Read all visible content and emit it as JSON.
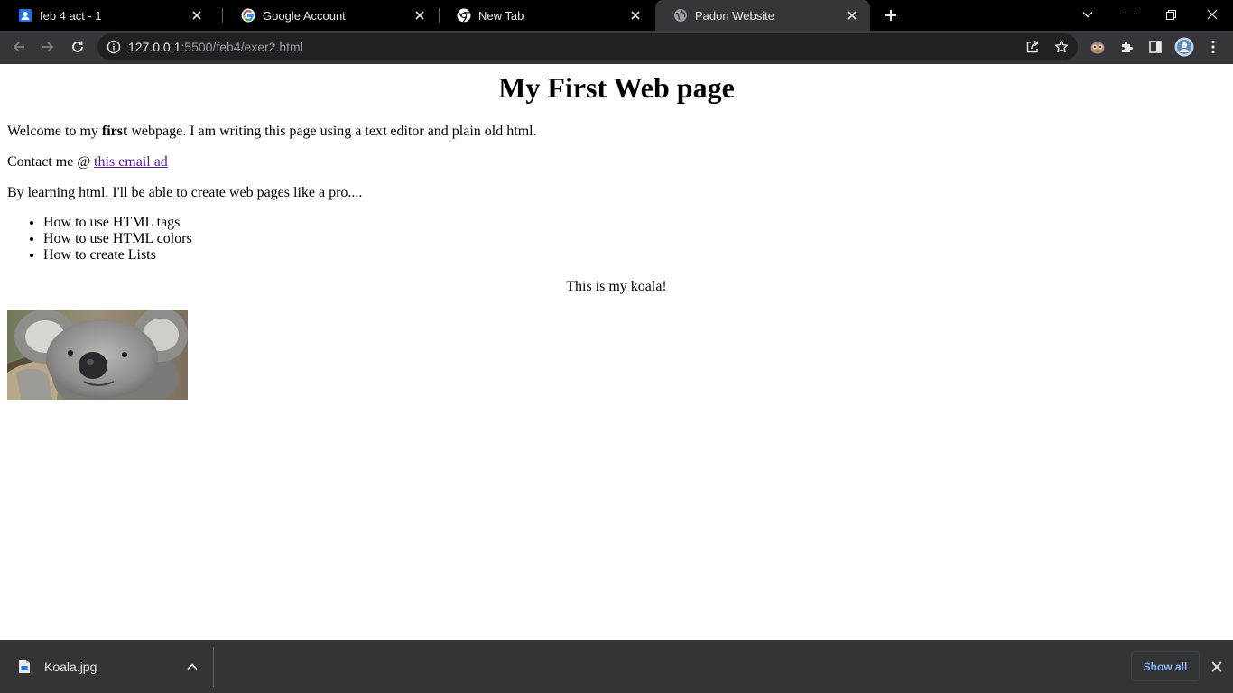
{
  "browser": {
    "tabs": [
      {
        "title": "feb 4 act - 1",
        "icon": "contacts-icon",
        "active": false
      },
      {
        "title": "Google Account",
        "icon": "google-icon",
        "active": false
      },
      {
        "title": "New Tab",
        "icon": "chrome-icon",
        "active": false
      },
      {
        "title": "Padon Website",
        "icon": "globe-icon",
        "active": true
      }
    ],
    "url_host": "127.0.0.1",
    "url_rest": ":5500/feb4/exer2.html"
  },
  "page": {
    "heading": "My First Web page",
    "welcome_before": "Welcome to my ",
    "welcome_bold": "first",
    "welcome_after": " webpage. I am writing this page using a text editor and plain old html.",
    "contact_prefix": "Contact me @ ",
    "contact_link": "this email ad",
    "learning": "By learning html. I'll be able to create web pages like a pro....",
    "list_items": [
      "How to use HTML tags",
      "How to use HTML colors",
      "How to create Lists"
    ],
    "caption": "This is my koala!",
    "image_alt": "koala-image"
  },
  "downloads": {
    "file_name": "Koala.jpg",
    "show_all": "Show all"
  },
  "colors": {
    "tabstrip": "#000000",
    "toolbar": "#35363a",
    "omnibox": "#202124",
    "shelf": "#333437",
    "link_visited": "#551a8b",
    "show_all": "#8ab4f8"
  }
}
